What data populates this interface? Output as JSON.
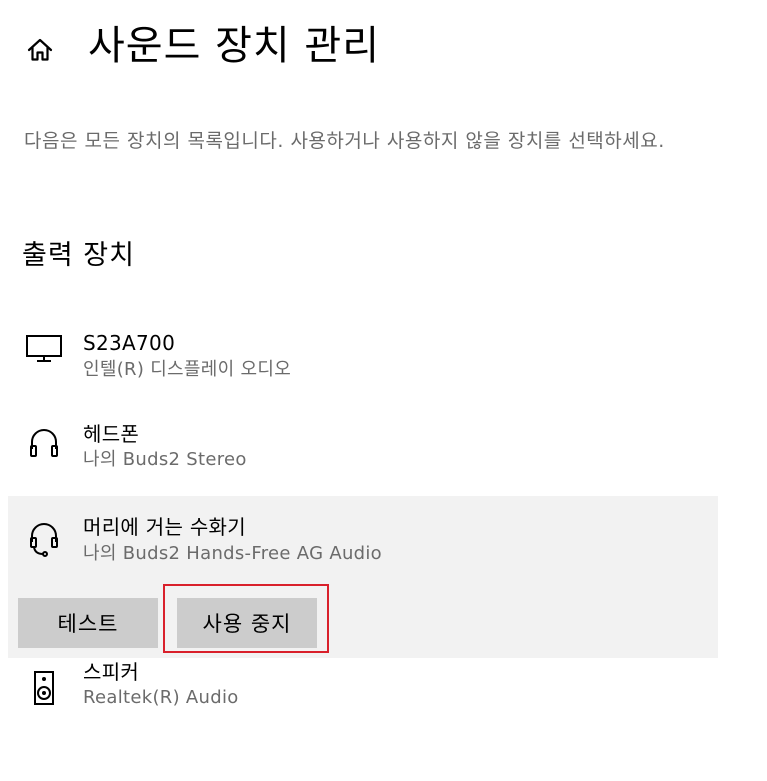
{
  "header": {
    "home_icon": "home-icon",
    "title": "사운드 장치 관리"
  },
  "description": "다음은 모든 장치의 목록입니다. 사용하거나 사용하지 않을 장치를 선택하세요.",
  "output_section": {
    "title": "출력 장치",
    "devices": [
      {
        "icon": "monitor-icon",
        "name": "S23A700",
        "subtitle": "인텔(R) 디스플레이 오디오"
      },
      {
        "icon": "headphones-icon",
        "name": "헤드폰",
        "subtitle": "나의 Buds2 Stereo"
      },
      {
        "icon": "headset-icon",
        "name": "머리에 거는 수화기",
        "subtitle": "나의 Buds2 Hands-Free AG Audio",
        "selected": true,
        "buttons": {
          "test_label": "테스트",
          "disable_label": "사용 중지"
        }
      },
      {
        "icon": "speaker-icon",
        "name": "스피커",
        "subtitle": "Realtek(R) Audio"
      }
    ]
  },
  "colors": {
    "background": "#ffffff",
    "selected_row": "#f2f2f2",
    "button": "#cccccc",
    "secondary_text": "#6b6b6b",
    "highlight_border": "#d9202b"
  }
}
